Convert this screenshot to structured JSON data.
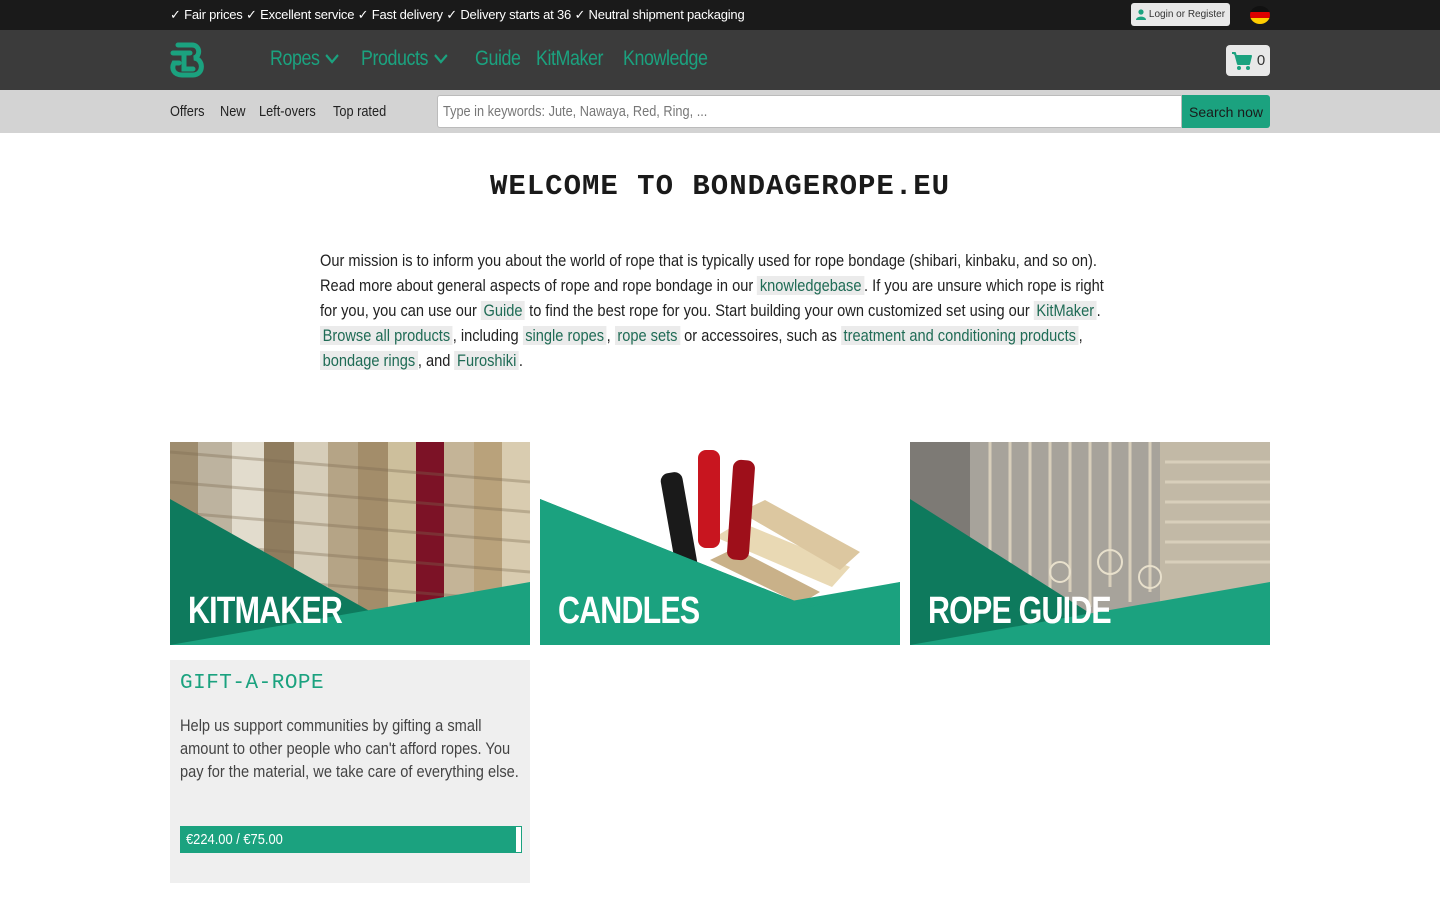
{
  "topbar": {
    "usp_text": "✓ Fair prices ✓ Excellent service ✓ Fast delivery ✓ Delivery starts at 36 ✓ Neutral shipment packaging",
    "login_label": "Login or Register"
  },
  "nav": {
    "items": [
      {
        "label": "Ropes",
        "dropdown": true
      },
      {
        "label": "Products",
        "dropdown": true
      },
      {
        "label": "Guide",
        "dropdown": false
      },
      {
        "label": "KitMaker",
        "dropdown": false
      },
      {
        "label": "Knowledge",
        "dropdown": false
      }
    ],
    "cart_count": "0"
  },
  "subnav": {
    "links": [
      "Offers",
      "New",
      "Left-overs",
      "Top rated"
    ],
    "search_placeholder": "Type in keywords: Jute, Nawaya, Red, Ring, ...",
    "search_button": "Search now"
  },
  "welcome_title": "WELCOME TO BONDAGEROPE.EU",
  "mission": {
    "t1": "Our mission is to inform you about the world of rope that is typically used for rope bondage (shibari, kinbaku, and so on). Read more about general aspects of rope and rope bondage in our ",
    "l1": "knowledgebase",
    "t2": ". If you are unsure which rope is right for you, you can use our ",
    "l2": "Guide",
    "t3": " to find the best rope for you. Start building your own customized set using our ",
    "l3": "KitMaker",
    "t4": ". ",
    "l4": "Browse all products",
    "t5": ", including ",
    "l5": "single ropes",
    "t6": ", ",
    "l6": "rope sets",
    "t7": " or accessoires, such as ",
    "l7": "treatment and conditioning products",
    "t8": ", ",
    "l8": "bondage rings",
    "t9": ", and ",
    "l9": "Furoshiki",
    "t10": "."
  },
  "tiles": [
    {
      "title": "KITMAKER"
    },
    {
      "title": "CANDLES"
    },
    {
      "title": "ROPE GUIDE"
    }
  ],
  "gift": {
    "title": "GIFT-A-ROPE",
    "text": "Help us support communities by gifting a small amount to other people who can't afford ropes. You pay for the material, we take care of everything else.",
    "progress_label": "€224.00 / €75.00",
    "progress_fraction": 0.985
  },
  "colors": {
    "accent": "#1ba27f",
    "topbar": "#1a1a1a",
    "navbar": "#3b3b3b",
    "subbar": "#d3d3d3"
  }
}
